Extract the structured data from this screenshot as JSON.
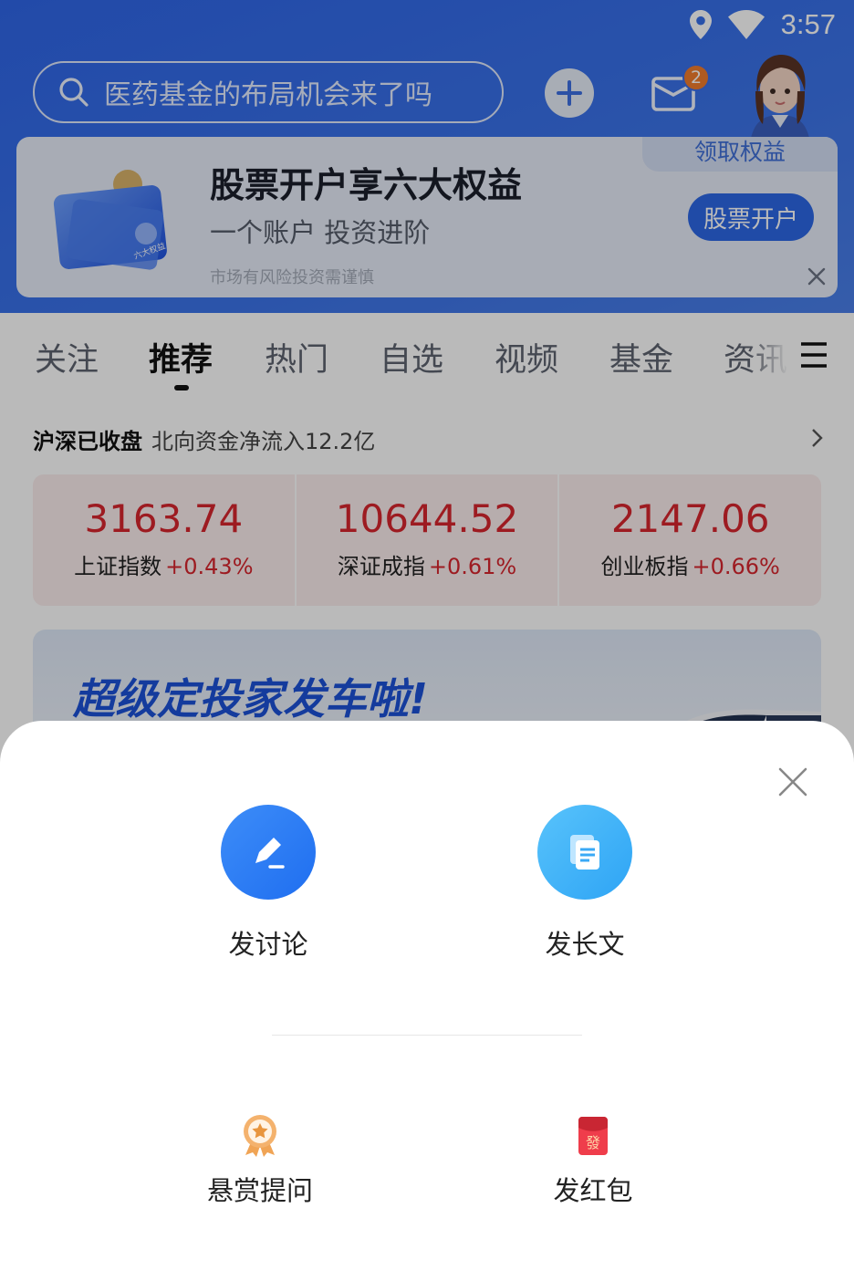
{
  "status_bar": {
    "time": "3:57",
    "icons": [
      "location-icon",
      "wifi-icon"
    ]
  },
  "header": {
    "search_placeholder": "医药基金的布局机会来了吗",
    "mail_badge": "2",
    "colors": {
      "header_blue": "#3b73ea",
      "accent_red": "#d7262e"
    }
  },
  "promo": {
    "tag": "领取权益",
    "title": "股票开户享六大权益",
    "subtitle": "一个账户 投资进阶",
    "note": "市场有风险投资需谨慎",
    "button": "股票开户",
    "art_label": "六大权益"
  },
  "tabs": [
    {
      "label": "关注"
    },
    {
      "label": "推荐"
    },
    {
      "label": "热门"
    },
    {
      "label": "自选"
    },
    {
      "label": "视频"
    },
    {
      "label": "基金"
    },
    {
      "label": "资讯"
    }
  ],
  "market": {
    "status": "沪深已收盘",
    "flow": "北向资金净流入12.2亿",
    "indices": [
      {
        "value": "3163.74",
        "name": "上证指数",
        "change": "+0.43%"
      },
      {
        "value": "10644.52",
        "name": "深证成指",
        "change": "+0.61%"
      },
      {
        "value": "2147.06",
        "name": "创业板指",
        "change": "+0.66%"
      }
    ]
  },
  "banner": {
    "text": "超级定投家发车啦!"
  },
  "sheet": {
    "primary_actions": [
      {
        "label": "发讨论",
        "icon": "pencil-icon"
      },
      {
        "label": "发长文",
        "icon": "document-icon"
      }
    ],
    "secondary_actions": [
      {
        "label": "悬赏提问",
        "icon": "medal-icon"
      },
      {
        "label": "发红包",
        "icon": "red-envelope-icon"
      }
    ],
    "envelope_char": "發"
  }
}
